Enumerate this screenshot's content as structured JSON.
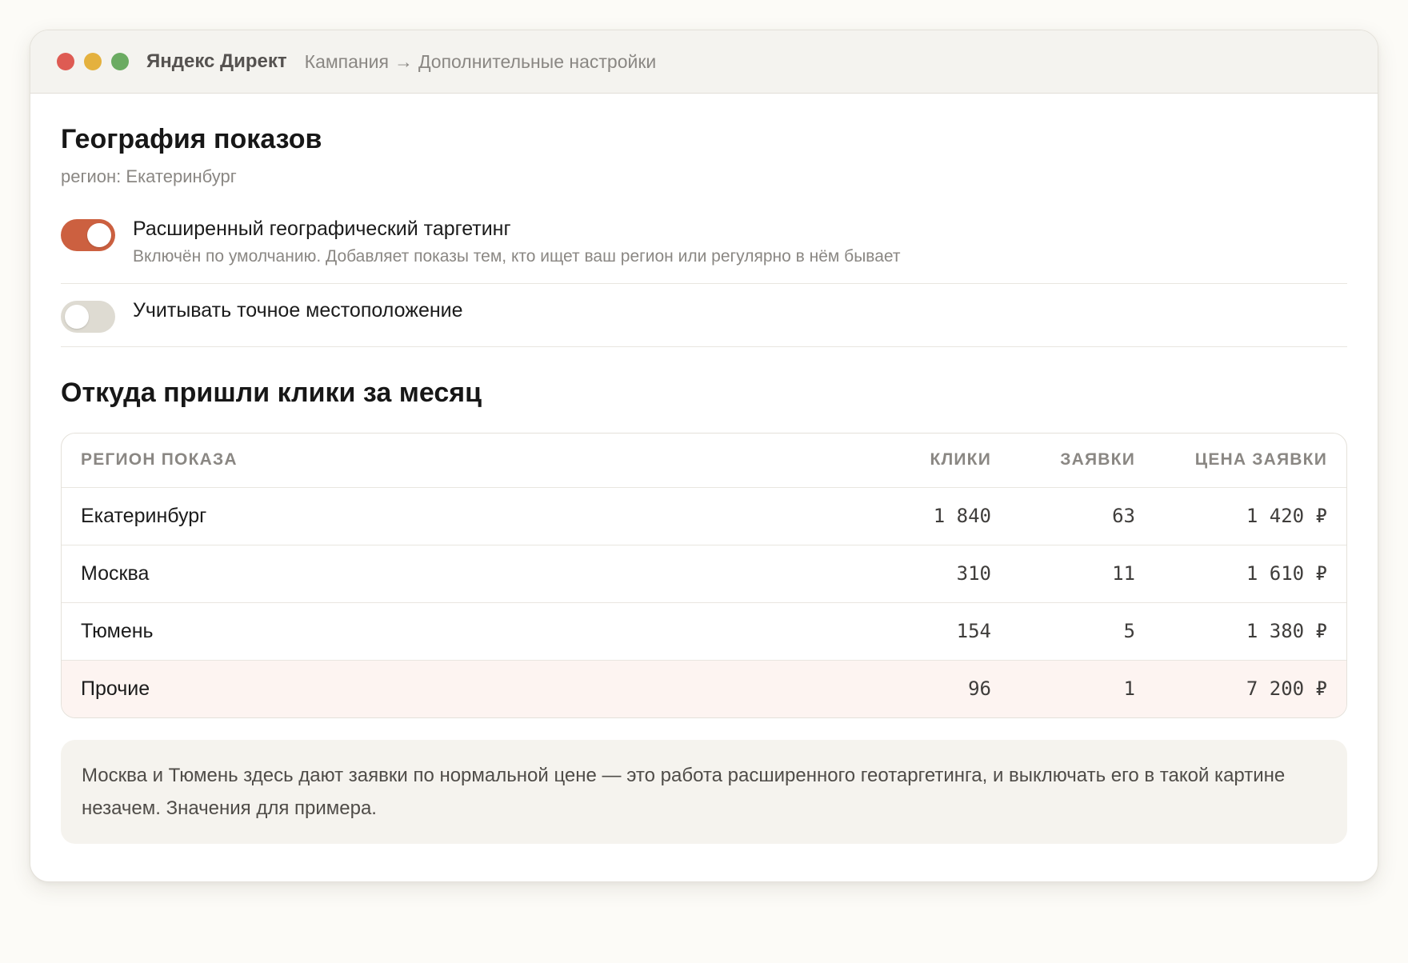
{
  "window": {
    "app_title": "Яндекс Директ",
    "breadcrumb": {
      "first": "Кампания",
      "separator": "→",
      "second": "Дополнительные настройки"
    }
  },
  "geo": {
    "title": "География показов",
    "region_label": "регион: Екатеринбург"
  },
  "settings": [
    {
      "label": "Расширенный географический таргетинг",
      "description": "Включён по умолчанию. Добавляет показы тем, кто ищет ваш регион или регулярно в нём бывает",
      "enabled": true
    },
    {
      "label": "Учитывать точное местоположение",
      "enabled": false
    }
  ],
  "clicks_section": {
    "title": "Откуда пришли клики за месяц"
  },
  "table": {
    "headers": {
      "region": "РЕГИОН ПОКАЗА",
      "clicks": "КЛИКИ",
      "leads": "ЗАЯВКИ",
      "price": "ЦЕНА ЗАЯВКИ"
    },
    "rows": [
      {
        "region": "Екатеринбург",
        "clicks": "1 840",
        "leads": "63",
        "price": "1 420 ₽"
      },
      {
        "region": "Москва",
        "clicks": "310",
        "leads": "11",
        "price": "1 610 ₽"
      },
      {
        "region": "Тюмень",
        "clicks": "154",
        "leads": "5",
        "price": "1 380 ₽"
      },
      {
        "region": "Прочие",
        "clicks": "96",
        "leads": "1",
        "price": "7 200 ₽",
        "highlighted": true
      }
    ]
  },
  "note": {
    "text": "Москва и Тюмень здесь дают заявки по нормальной цене — это работа расширенного геотаргетинга, и выключать его в такой картине незачем. Значения для примера."
  },
  "colors": {
    "accent": "#cc6040",
    "toggle_off": "#dedbd2",
    "highlight_row": "#fdf4f1",
    "dot_red": "#de5b53",
    "dot_yellow": "#e4b13e",
    "dot_green": "#6bab62"
  }
}
